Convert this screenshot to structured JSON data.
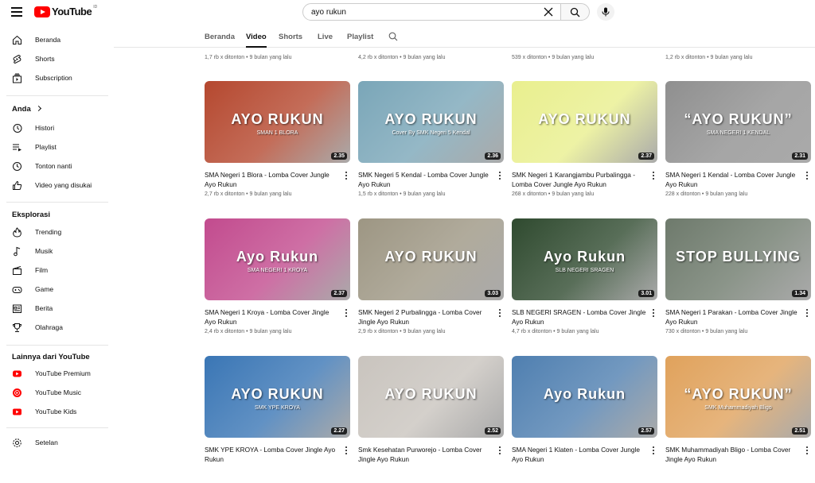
{
  "header": {
    "logo_text": "YouTube",
    "logo_region": "ID",
    "search_value": "ayo rukun"
  },
  "sidebar": {
    "main": [
      {
        "label": "Beranda",
        "icon": "home-icon"
      },
      {
        "label": "Shorts",
        "icon": "shorts-icon"
      },
      {
        "label": "Subscription",
        "icon": "subscriptions-icon"
      }
    ],
    "you_heading": "Anda",
    "you": [
      {
        "label": "Histori",
        "icon": "history-icon"
      },
      {
        "label": "Playlist",
        "icon": "playlist-icon"
      },
      {
        "label": "Tonton nanti",
        "icon": "watch-later-icon"
      },
      {
        "label": "Video yang disukai",
        "icon": "like-icon"
      }
    ],
    "explore_heading": "Eksplorasi",
    "explore": [
      {
        "label": "Trending",
        "icon": "trending-icon"
      },
      {
        "label": "Musik",
        "icon": "music-icon"
      },
      {
        "label": "Film",
        "icon": "film-icon"
      },
      {
        "label": "Game",
        "icon": "game-icon"
      },
      {
        "label": "Berita",
        "icon": "news-icon"
      },
      {
        "label": "Olahraga",
        "icon": "sports-icon"
      }
    ],
    "more_heading": "Lainnya dari YouTube",
    "more": [
      {
        "label": "YouTube Premium",
        "icon": "youtube-premium-icon"
      },
      {
        "label": "YouTube Music",
        "icon": "youtube-music-icon"
      },
      {
        "label": "YouTube Kids",
        "icon": "youtube-kids-icon"
      }
    ],
    "settings": {
      "label": "Setelan",
      "icon": "settings-icon"
    }
  },
  "tabs": [
    {
      "label": "Beranda",
      "active": false
    },
    {
      "label": "Video",
      "active": true
    },
    {
      "label": "Shorts",
      "active": false
    },
    {
      "label": "Live",
      "active": false
    },
    {
      "label": "Playlist",
      "active": false
    }
  ],
  "top_partial_meta": [
    "1,7 rb x ditonton • 9 bulan yang lalu",
    "4,2 rb x ditonton • 9 bulan yang lalu",
    "539 x ditonton • 9 bulan yang lalu",
    "1,2 rb x ditonton • 9 bulan yang lalu"
  ],
  "videos": [
    {
      "title": "SMA Negeri 1 Blora - Lomba Cover Jungle Ayo Rukun",
      "meta": "2,7 rb x ditonton • 9 bulan yang lalu",
      "duration": "2.35",
      "thumb_text": "AYO RUKUN",
      "thumb_sub": "SMAN 1 BLORA",
      "bg": "#b5482f"
    },
    {
      "title": "SMK Negeri 5 Kendal - Lomba Cover Jungle Ayo Rukun",
      "meta": "1,5 rb x ditonton • 9 bulan yang lalu",
      "duration": "2.36",
      "thumb_text": "AYO RUKUN",
      "thumb_sub": "Cover By SMK Negeri 5 Kendal",
      "bg": "#7aa6b8"
    },
    {
      "title": "SMK Negeri 1 Karangjambu Purbalingga - Lomba Cover Jungle Ayo Rukun",
      "meta": "268 x ditonton • 9 bulan yang lalu",
      "duration": "2.37",
      "thumb_text": "AYO RUKUN",
      "thumb_sub": "",
      "bg": "#e9ef8e"
    },
    {
      "title": "SMA Negeri 1 Kendal - Lomba Cover Jungle Ayo Rukun",
      "meta": "228 x ditonton • 9 bulan yang lalu",
      "duration": "2.31",
      "thumb_text": "“AYO RUKUN”",
      "thumb_sub": "SMA NEGERI 1 KENDAL",
      "bg": "#8f8f8f"
    },
    {
      "title": "SMA Negeri 1 Kroya - Lomba Cover Jingle Ayo Rukun",
      "meta": "2,4 rb x ditonton • 9 bulan yang lalu",
      "duration": "2.37",
      "thumb_text": "Ayo Rukun",
      "thumb_sub": "SMA NEGERI 1 KROYA",
      "bg": "#c24b8e"
    },
    {
      "title": "SMK Negeri 2 Purbalingga - Lomba Cover Jingle Ayo Rukun",
      "meta": "2,9 rb x ditonton • 9 bulan yang lalu",
      "duration": "3.03",
      "thumb_text": "AYO RUKUN",
      "thumb_sub": "",
      "bg": "#9d9683"
    },
    {
      "title": "SLB NEGERI SRAGEN - Lomba Cover Jingle Ayo Rukun",
      "meta": "4,7 rb x ditonton • 9 bulan yang lalu",
      "duration": "3.01",
      "thumb_text": "Ayo Rukun",
      "thumb_sub": "SLB NEGERI SRAGEN",
      "bg": "#2f4a2f"
    },
    {
      "title": "SMA Negeri 1 Parakan - Lomba Cover Jingle Ayo Rukun",
      "meta": "730 x ditonton • 9 bulan yang lalu",
      "duration": "1.34",
      "thumb_text": "STOP BULLYING",
      "thumb_sub": "",
      "bg": "#6e7a6c"
    },
    {
      "title": "SMK YPE KROYA - Lomba Cover Jingle Ayo Rukun",
      "meta": "",
      "duration": "2.27",
      "thumb_text": "AYO RUKUN",
      "thumb_sub": "SMK YPE KROYA",
      "bg": "#3a76b5"
    },
    {
      "title": "Smk Kesehatan Purworejo - Lomba Cover Jingle Ayo Rukun",
      "meta": "",
      "duration": "2.52",
      "thumb_text": "AYO RUKUN",
      "thumb_sub": "",
      "bg": "#c9c4be"
    },
    {
      "title": "SMA Negeri 1 Klaten - Lomba Cover Jungle Ayo Rukun",
      "meta": "",
      "duration": "2.57",
      "thumb_text": "Ayo Rukun",
      "thumb_sub": "",
      "bg": "#4f7fb0"
    },
    {
      "title": "SMK Muhammadiyah Bligo - Lomba Cover Jingle Ayo Rukun",
      "meta": "",
      "duration": "2.51",
      "thumb_text": "“AYO RUKUN”",
      "thumb_sub": "SMK Muhammadiyah Bligo",
      "bg": "#e0a25c"
    }
  ]
}
